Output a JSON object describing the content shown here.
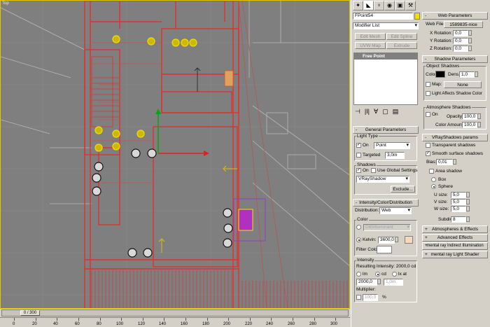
{
  "viewport": {
    "label": "Top"
  },
  "timeline": {
    "frame": "0 / 300",
    "ticks": [
      "0",
      "20",
      "40",
      "60",
      "80",
      "100",
      "120",
      "140",
      "160",
      "180",
      "200",
      "220",
      "240",
      "260",
      "280",
      "300"
    ]
  },
  "command_panel": {
    "object_name": "FPoint54",
    "modifier_list": "Modifier List",
    "buttons": {
      "edit_mesh": "Edit Mesh",
      "edit_spline": "Edit Spline",
      "uvw_map": "UVW Map",
      "extrude": "Extrude"
    },
    "stack_item": "Free Point",
    "general": {
      "title": "General Parameters",
      "light_type": "Light Type",
      "on": "On",
      "type_value": "Point",
      "targeted": "Targeted",
      "target_value": "3,0m",
      "shadows": "Shadows",
      "shadows_on": "On",
      "use_global": "Use Global Settings",
      "shadow_type": "VRayShadow",
      "exclude": "Exclude..."
    },
    "intensity": {
      "title": "Intensity/Color/Distribution",
      "distribution_label": "Distribution:",
      "distribution": "Web",
      "color_group": "Color",
      "color_preset": "D65Illuminant",
      "kelvin": "Kelvin:",
      "kelvin_value": "3600,0",
      "filter_color": "Filter Color:",
      "intensity_group": "Intensity",
      "resulting": "Resulting Intensity: 2000,0 cd",
      "lm": "lm",
      "cd": "cd",
      "lx": "lx at",
      "value": "2000,0",
      "dist": "1,0m",
      "multiplier": "Multiplier:",
      "mult_value": "100,0",
      "pct": "%"
    }
  },
  "right_panel": {
    "web": {
      "title": "Web Parameters",
      "web_file": "Web File:",
      "file_value": "1589835-nice",
      "xrot": "X Rotation:",
      "yrot": "Y Rotation:",
      "zrot": "Z Rotation:",
      "xval": "0,0",
      "yval": "0,0",
      "zval": "0,0"
    },
    "shadow": {
      "title": "Shadow Parameters",
      "object_shadows": "Object Shadows",
      "color": "Color:",
      "dens": "Dens.",
      "dens_value": "1,0",
      "map": "Map:",
      "map_value": "None",
      "light_affects": "Light Affects Shadow Color",
      "atmo": "Atmosphere Shadows",
      "on": "On",
      "opacity": "Opacity:",
      "opacity_value": "100,0",
      "color_amount": "Color Amount:",
      "color_amount_value": "100,0"
    },
    "vray": {
      "title": "VRayShadows params",
      "transparent": "Transparent shadows",
      "smooth": "Smooth surface shadows",
      "bias": "Bias:",
      "bias_value": "0,01",
      "area": "Area shadow",
      "box": "Box",
      "sphere": "Sphere",
      "usize": "U size:",
      "vsize": "V size:",
      "wsize": "W size:",
      "uval": "5,0",
      "vval": "5,0",
      "wval": "5,0",
      "subdivs": "Subdivs:",
      "subdivs_value": "8"
    },
    "rollouts": [
      "Atmospheres & Effects",
      "Advanced Effects",
      "mental ray Indirect Illumination",
      "mental ray Light Shader"
    ]
  },
  "colors": {
    "accent": "#e3c600",
    "wire_red": "#e03030",
    "kelvin_swatch": "#f8d8bc",
    "shadow_color": "#000000"
  }
}
